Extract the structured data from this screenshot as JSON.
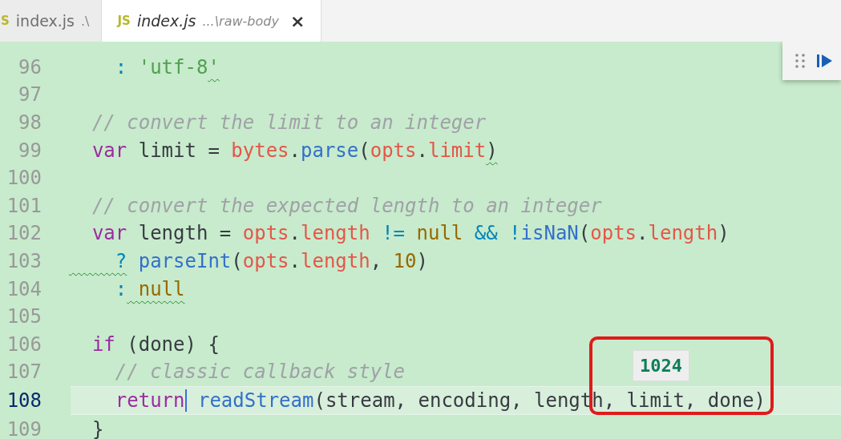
{
  "tabs": [
    {
      "icon": "S",
      "name": "index.js",
      "path": ".\\",
      "selected": false
    },
    {
      "icon": "JS",
      "name": "index.js",
      "path": "...\\raw-body",
      "selected": true,
      "close": "×"
    }
  ],
  "editor": {
    "lines": [
      {
        "number": "96",
        "current": false,
        "tokens": [
          {
            "kind": "punct",
            "t": "    :"
          },
          {
            "kind": "str",
            "t": " 'utf-8"
          },
          {
            "kind": "str",
            "t": "'",
            "squiggle": true
          }
        ]
      },
      {
        "number": "97",
        "current": false
      },
      {
        "number": "98",
        "current": false,
        "tokens": [
          {
            "kind": "comment",
            "t": "  // convert the limit to an integer"
          }
        ]
      },
      {
        "number": "99",
        "current": false,
        "tokens": [
          {
            "kind": "kw",
            "t": "  var"
          },
          {
            "kind": "plain",
            "t": " limit ="
          },
          {
            "kind": "prop",
            "t": " bytes"
          },
          {
            "kind": "plain",
            "t": "."
          },
          {
            "kind": "func",
            "t": "parse"
          },
          {
            "kind": "plain",
            "t": "("
          },
          {
            "kind": "prop",
            "t": "opts"
          },
          {
            "kind": "plain",
            "t": "."
          },
          {
            "kind": "prop",
            "t": "limit"
          },
          {
            "kind": "plain",
            "t": ")",
            "squiggle": true
          }
        ]
      },
      {
        "number": "100",
        "current": false
      },
      {
        "number": "101",
        "current": false,
        "tokens": [
          {
            "kind": "comment",
            "t": "  // convert the expected length to an integer"
          }
        ]
      },
      {
        "number": "102",
        "current": false,
        "tokens": [
          {
            "kind": "kw",
            "t": "  var"
          },
          {
            "kind": "plain",
            "t": " length ="
          },
          {
            "kind": "prop",
            "t": " opts"
          },
          {
            "kind": "plain",
            "t": "."
          },
          {
            "kind": "prop",
            "t": "length"
          },
          {
            "kind": "op",
            "t": " !="
          },
          {
            "kind": "num",
            "t": " null"
          },
          {
            "kind": "op",
            "t": " && !"
          },
          {
            "kind": "func",
            "t": "isNaN"
          },
          {
            "kind": "plain",
            "t": "("
          },
          {
            "kind": "prop",
            "t": "opts"
          },
          {
            "kind": "plain",
            "t": "."
          },
          {
            "kind": "prop",
            "t": "length"
          },
          {
            "kind": "plain",
            "t": ")"
          }
        ]
      },
      {
        "number": "103",
        "current": false,
        "tokens": [
          {
            "kind": "punct",
            "t": "    ?",
            "squiggle": true
          },
          {
            "kind": "func",
            "t": " parseInt"
          },
          {
            "kind": "plain",
            "t": "("
          },
          {
            "kind": "prop",
            "t": "opts"
          },
          {
            "kind": "plain",
            "t": "."
          },
          {
            "kind": "prop",
            "t": "length"
          },
          {
            "kind": "plain",
            "t": ","
          },
          {
            "kind": "num",
            "t": " 10"
          },
          {
            "kind": "plain",
            "t": ")"
          }
        ]
      },
      {
        "number": "104",
        "current": false,
        "tokens": [
          {
            "kind": "punct",
            "t": "    :"
          },
          {
            "kind": "num",
            "t": " null",
            "squiggle": true
          }
        ]
      },
      {
        "number": "105",
        "current": false
      },
      {
        "number": "106",
        "current": false,
        "tokens": [
          {
            "kind": "kw",
            "t": "  if"
          },
          {
            "kind": "plain",
            "t": " (done) {"
          }
        ]
      },
      {
        "number": "107",
        "current": false,
        "tokens": [
          {
            "kind": "comment",
            "t": "    // classic callback style"
          }
        ]
      },
      {
        "number": "108",
        "current": true,
        "tokens": [
          {
            "kind": "kw",
            "t": "    return"
          },
          {
            "kind": "func",
            "t": " readStream",
            "cursor": true
          },
          {
            "kind": "plain",
            "t": "(stream, encoding, length, limit, done"
          },
          {
            "kind": "plain",
            "t": ")",
            "squiggle": true
          }
        ]
      },
      {
        "number": "109",
        "current": false,
        "tokens": [
          {
            "kind": "plain",
            "t": "  }"
          }
        ]
      }
    ]
  },
  "hover": {
    "text": "1024",
    "highlighted": true
  }
}
